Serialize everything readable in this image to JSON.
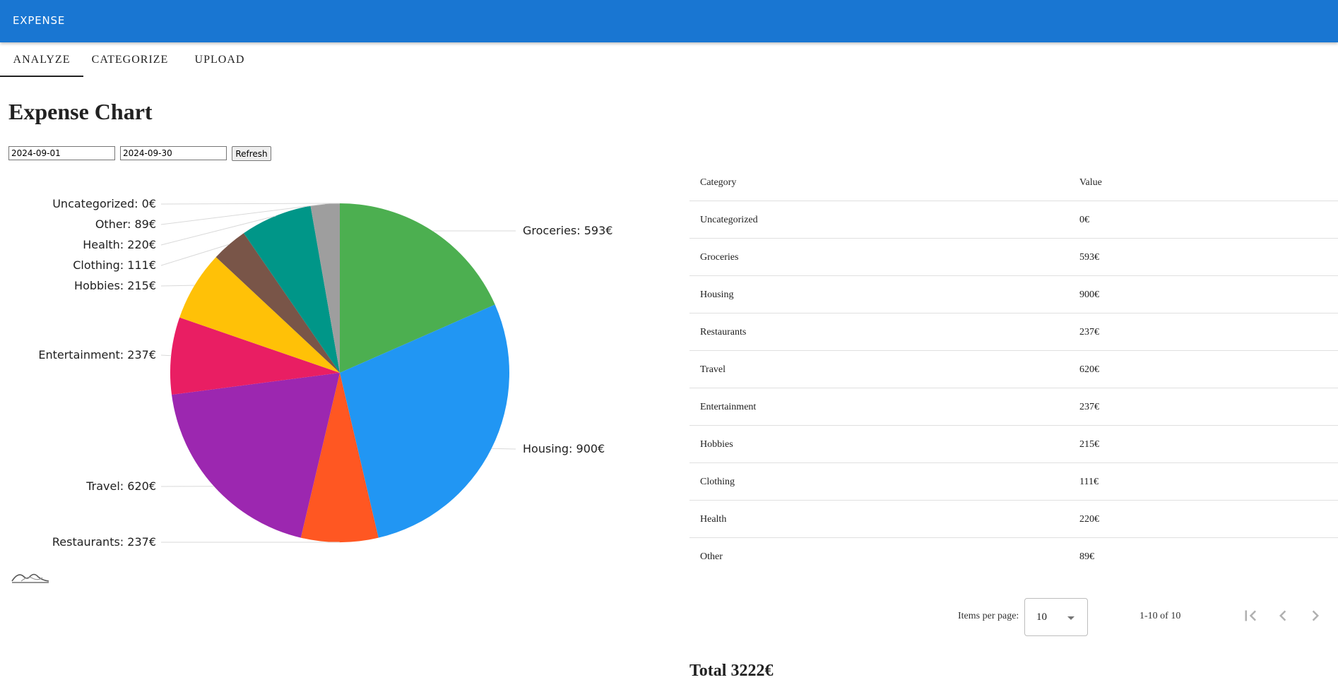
{
  "app": {
    "title": "EXPENSE"
  },
  "tabs": [
    {
      "label": "ANALYZE",
      "active": true
    },
    {
      "label": "CATEGORIZE",
      "active": false
    },
    {
      "label": "UPLOAD",
      "active": false
    }
  ],
  "page": {
    "title": "Expense Chart"
  },
  "filters": {
    "start_date": "2024-09-01",
    "end_date": "2024-09-30",
    "refresh_label": "Refresh"
  },
  "chart_data": {
    "type": "pie",
    "slices": [
      {
        "label": "Groceries",
        "value": 593,
        "color": "#4caf50"
      },
      {
        "label": "Housing",
        "value": 900,
        "color": "#2196f3"
      },
      {
        "label": "Restaurants",
        "value": 237,
        "color": "#ff5722"
      },
      {
        "label": "Travel",
        "value": 620,
        "color": "#9c27b0"
      },
      {
        "label": "Entertainment",
        "value": 237,
        "color": "#e91e63"
      },
      {
        "label": "Hobbies",
        "value": 215,
        "color": "#ffc107"
      },
      {
        "label": "Clothing",
        "value": 111,
        "color": "#795548"
      },
      {
        "label": "Health",
        "value": 220,
        "color": "#009688"
      },
      {
        "label": "Other",
        "value": 89,
        "color": "#9e9e9e"
      },
      {
        "label": "Uncategorized",
        "value": 0,
        "color": "#607d8b"
      }
    ],
    "data_labels": [
      "Uncategorized: 0€",
      "Other: 89€",
      "Health: 220€",
      "Clothing: 111€",
      "Hobbies: 215€",
      "Entertainment: 237€",
      "Travel: 620€",
      "Restaurants: 237€",
      "Groceries: 593€",
      "Housing: 900€"
    ],
    "legend": "none",
    "label_lines": true
  },
  "table": {
    "headers": {
      "category": "Category",
      "value": "Value"
    },
    "rows": [
      {
        "category": "Uncategorized",
        "value": "0€"
      },
      {
        "category": "Groceries",
        "value": "593€"
      },
      {
        "category": "Housing",
        "value": "900€"
      },
      {
        "category": "Restaurants",
        "value": "237€"
      },
      {
        "category": "Travel",
        "value": "620€"
      },
      {
        "category": "Entertainment",
        "value": "237€"
      },
      {
        "category": "Hobbies",
        "value": "215€"
      },
      {
        "category": "Clothing",
        "value": "111€"
      },
      {
        "category": "Health",
        "value": "220€"
      },
      {
        "category": "Other",
        "value": "89€"
      }
    ]
  },
  "paginator": {
    "items_per_page_label": "Items per page:",
    "items_per_page": "10",
    "range_label": "1-10 of 10",
    "icons": [
      "first-page-icon",
      "previous-page-icon",
      "next-page-icon"
    ]
  },
  "total": {
    "label": "Total 3222€"
  },
  "colors": {
    "toolbar": "#1976d2",
    "divider": "#e0e0e0"
  }
}
